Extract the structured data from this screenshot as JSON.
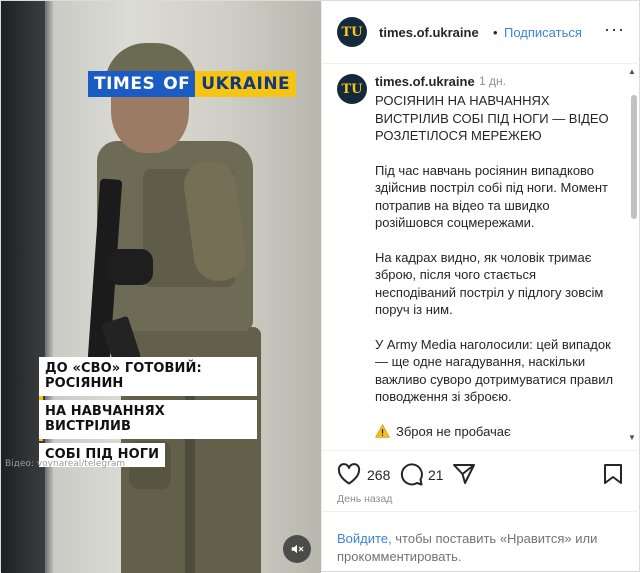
{
  "media": {
    "brand": {
      "part1": "TIMES",
      "part2": "OF",
      "part3": "UKRAINE"
    },
    "caption_lines": [
      "ДО «СВО» ГОТОВИЙ: РОСІЯНИН",
      "НА НАВЧАННЯХ ВИСТРІЛИВ",
      "СОБІ ПІД НОГИ"
    ],
    "watermark": "Відео: voynareal/telegram",
    "mute_icon": "muted-speaker-icon"
  },
  "header": {
    "avatar_initials": "TU",
    "username": "times.of.ukraine",
    "dot": "•",
    "follow_label": "Подписаться",
    "more_label": "···"
  },
  "caption": {
    "avatar_initials": "TU",
    "username": "times.of.ukraine",
    "time": "1 дн.",
    "paragraphs": [
      "РОСІЯНИН НА НАВЧАННЯХ ВИСТРІЛИВ СОБІ ПІД НОГИ — ВІДЕО РОЗЛЕТІЛОСЯ МЕРЕЖЕЮ",
      "Під час навчань росіянин випадково здійснив постріл собі під ноги. Момент потрапив на відео та швидко розійшовся соцмережами.",
      "На кадрах видно, як чоловік тримає зброю, після чого стається несподіваний постріл у підлогу зовсім поруч із ним.",
      "У Army Media наголосили: цей випадок — ще одне нагадування, наскільки важливо суворо дотримуватися правил поводження зі зброєю."
    ],
    "warning_icon": "warning-icon",
    "warning_text": "Зброя не пробачає"
  },
  "actions": {
    "likes": "268",
    "comments": "21",
    "posted": "День назад"
  },
  "login_prompt": {
    "link": "Войдите",
    "text": ", чтобы поставить «Нравится» или прокомментировать."
  },
  "colors": {
    "accent_link": "#3b84d8",
    "brand_blue": "#1a5bc4",
    "brand_yellow": "#f6c514",
    "avatar_bg": "#14293b"
  }
}
